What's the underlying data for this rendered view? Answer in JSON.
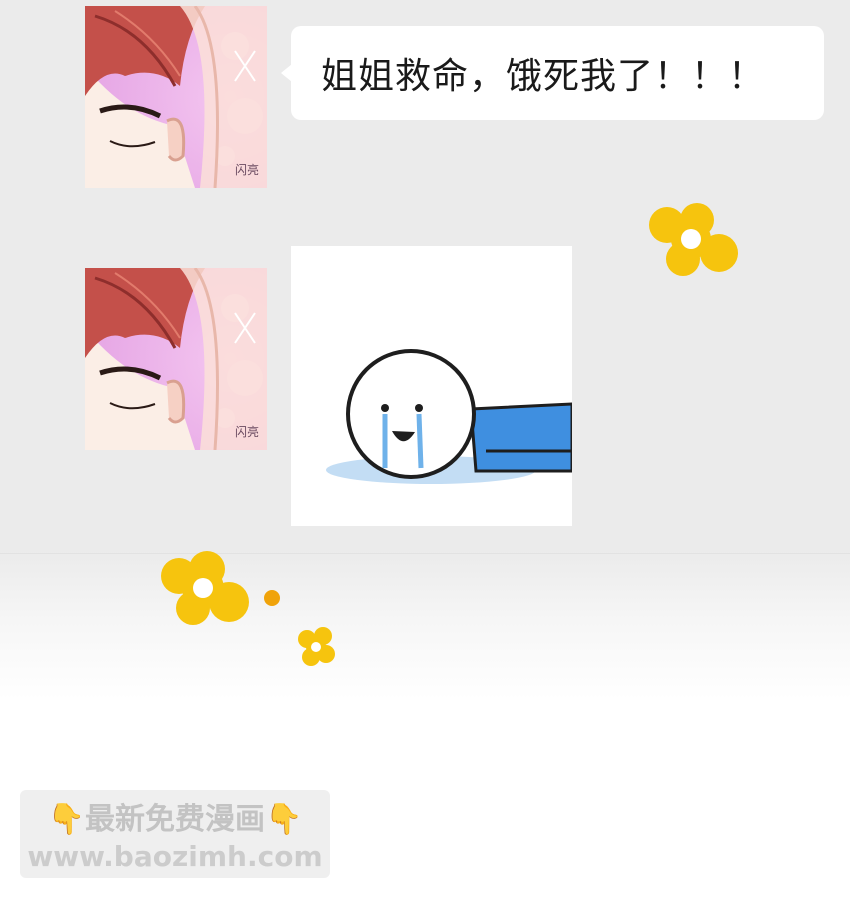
{
  "messages": [
    {
      "type": "text",
      "text": "姐姐救命，饿死我了！！！"
    },
    {
      "type": "sticker",
      "icon": "crying-stickman-lying-icon"
    }
  ],
  "avatar": {
    "icon": "red-haired-man-avatar-icon",
    "stamp_text": "闪亮"
  },
  "watermark": {
    "line1": "👇最新免费漫画👇",
    "line2": "www.baozimh.com"
  },
  "colors": {
    "background": "#ebebeb",
    "bubble": "#ffffff",
    "flower": "#f6c40e",
    "sticker_body": "#3f8fe0"
  }
}
